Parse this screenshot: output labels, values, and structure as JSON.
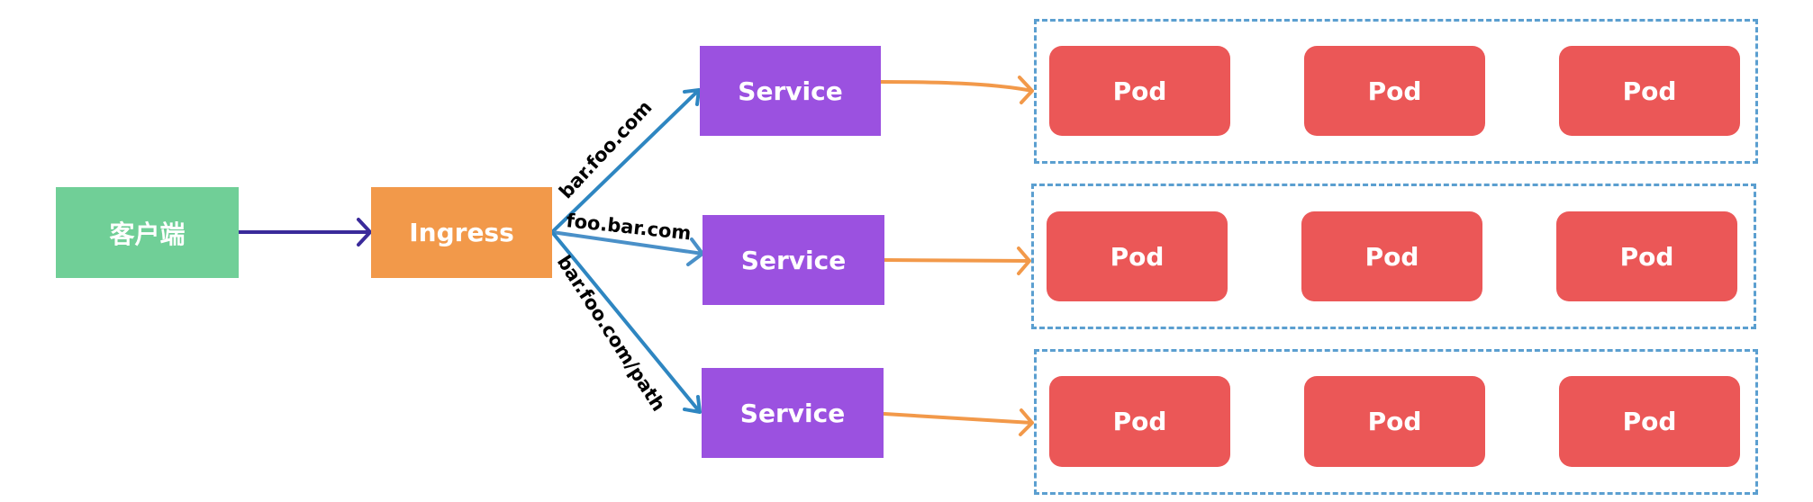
{
  "client": {
    "label": "客户端"
  },
  "ingress": {
    "label": "Ingress"
  },
  "routes": [
    {
      "host": "bar.foo.com",
      "service": "Service"
    },
    {
      "host": "foo.bar.com",
      "service": "Service"
    },
    {
      "host": "bar.foo.com/path",
      "service": "Service"
    }
  ],
  "groups": [
    {
      "pods": [
        "Pod",
        "Pod",
        "Pod"
      ]
    },
    {
      "pods": [
        "Pod",
        "Pod",
        "Pod"
      ]
    },
    {
      "pods": [
        "Pod",
        "Pod",
        "Pod"
      ]
    }
  ],
  "colors": {
    "client": "#70cf97",
    "ingress": "#f2994a",
    "service": "#9b51e0",
    "pod": "#eb5757",
    "route_arrow": "#2e86c1",
    "pod_arrow": "#f2994a",
    "client_arrow": "#3a2a9a",
    "group_border": "#5b9fd0"
  }
}
